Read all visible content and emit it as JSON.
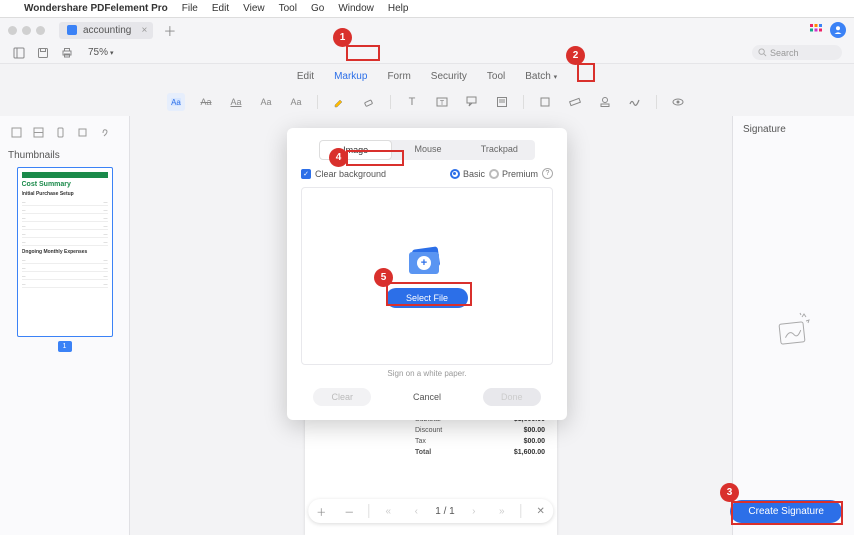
{
  "menubar": {
    "app_name": "Wondershare PDFelement Pro",
    "items": [
      "File",
      "Edit",
      "View",
      "Tool",
      "Go",
      "Window",
      "Help"
    ]
  },
  "tab": {
    "title": "accounting",
    "zoom": "75%"
  },
  "ribbon": {
    "tabs": [
      "Edit",
      "Markup",
      "Form",
      "Security",
      "Tool",
      "Batch"
    ],
    "active": "Markup"
  },
  "left_panel": {
    "title": "Thumbnails",
    "page_badge": "1",
    "thumb": {
      "heading": "Cost Summary",
      "section1": "Initial Purchase Setup",
      "section2": "Ongoing Monthly Expenses"
    }
  },
  "right_panel": {
    "title": "Signature"
  },
  "create_button": "Create Signature",
  "pager": {
    "current": "1",
    "total": "1"
  },
  "page_summary": {
    "rows": [
      {
        "label": "Subtotal",
        "value": "$1,600.00"
      },
      {
        "label": "Discount",
        "value": "$00.00"
      },
      {
        "label": "Tax",
        "value": "$00.00"
      },
      {
        "label": "Total",
        "value": "$1,600.00"
      }
    ]
  },
  "modal": {
    "tabs": [
      "Image",
      "Mouse",
      "Trackpad"
    ],
    "active_tab": "Image",
    "clear_bg": "Clear background",
    "basic": "Basic",
    "premium": "Premium",
    "select_file": "Select File",
    "hint": "Sign on a white paper.",
    "clear": "Clear",
    "cancel": "Cancel",
    "done": "Done"
  },
  "search_placeholder": "Search",
  "callouts": {
    "1": "1",
    "2": "2",
    "3": "3",
    "4": "4",
    "5": "5"
  }
}
